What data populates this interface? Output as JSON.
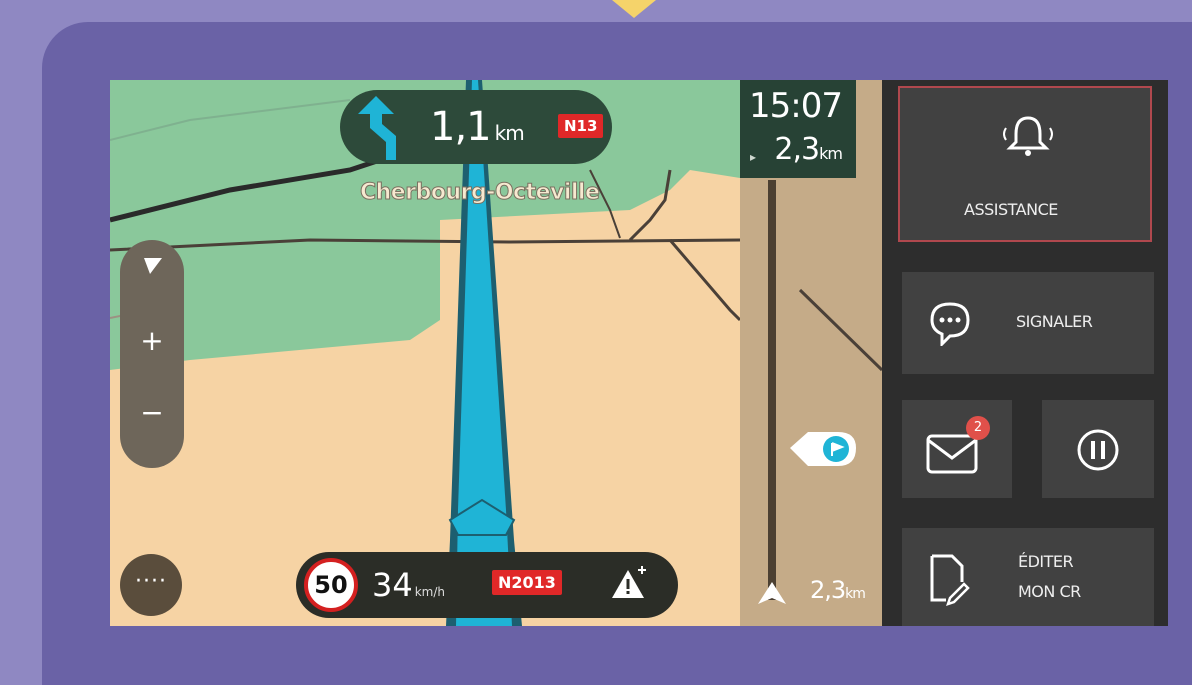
{
  "instruction": {
    "distance": "1,1",
    "unit": "km",
    "road": "N13"
  },
  "city": "Cherbourg-Octeville",
  "eta": {
    "time": "15:07",
    "remaining": "2,3",
    "remaining_unit": "km"
  },
  "strip": {
    "distance": "2,3",
    "unit": "km"
  },
  "zoom": {
    "plus": "+",
    "minus": "−"
  },
  "menu": {
    "label": "····"
  },
  "speed": {
    "limit": "50",
    "current": "34",
    "unit": "km/h",
    "road": "N2013"
  },
  "tiles": {
    "assistance": {
      "label": "ASSISTANCE"
    },
    "signaler": {
      "label": "SIGNALER"
    },
    "messages": {
      "count": "2"
    },
    "editer": {
      "line1": "ÉDITER",
      "line2": "MON CR"
    }
  },
  "colors": {
    "route": "#1fb4d6",
    "alert": "#e02828",
    "panel": "#414141",
    "map_land": "#f6d3a4",
    "map_green": "#8ac89b"
  }
}
